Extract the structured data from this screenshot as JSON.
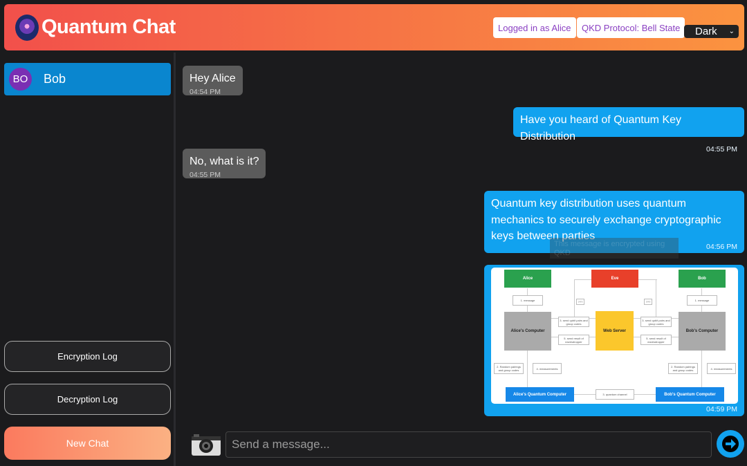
{
  "header": {
    "title": "Quantum Chat",
    "logged_in": "Logged in as Alice",
    "protocol": "QKD Protocol: Bell State",
    "theme": "Dark"
  },
  "sidebar": {
    "contacts": [
      {
        "initials": "BO",
        "name": "Bob"
      }
    ],
    "encryption_log": "Encryption Log",
    "decryption_log": "Decryption Log",
    "new_chat": "New Chat"
  },
  "messages": [
    {
      "dir": "in",
      "text": "Hey Alice",
      "time": "04:54 PM"
    },
    {
      "dir": "out",
      "text": "Have you heard of Quantum Key Distribution",
      "time": "04:55 PM"
    },
    {
      "dir": "in",
      "text": "No, what is it?",
      "time": "04:55 PM"
    },
    {
      "dir": "out",
      "text": "Quantum key distribution uses quantum mechanics to securely exchange cryptographic keys between parties",
      "time": "04:56 PM",
      "tooltip": "This message is encrypted using QKD"
    },
    {
      "dir": "out",
      "type": "image",
      "time": "04:59 PM"
    }
  ],
  "diagram": {
    "alice": "Alice",
    "eve": "Eve",
    "bob": "Bob",
    "message": "1. message",
    "alice_pc": "Alice's Computer",
    "web_server": "Web Server",
    "bob_pc": "Bob's Computer",
    "send_qubits": "3. send qubit pairs and group codes",
    "send_result": "5. send result of eavesdropper",
    "unknown": "???",
    "random": "2. Random pairings and group codes",
    "measurements": "4. measurements",
    "alice_qc": "Alice's Quantum Computer",
    "bob_qc": "Bob's Quantum Computer",
    "channel": "3. quantum channel"
  },
  "composer": {
    "placeholder": "Send a message..."
  },
  "colors": {
    "header_start": "#f2504b",
    "header_end": "#fb9340",
    "outgoing": "#11a2ef",
    "incoming": "#5b5b5b",
    "contact_active": "#0a86cf"
  }
}
